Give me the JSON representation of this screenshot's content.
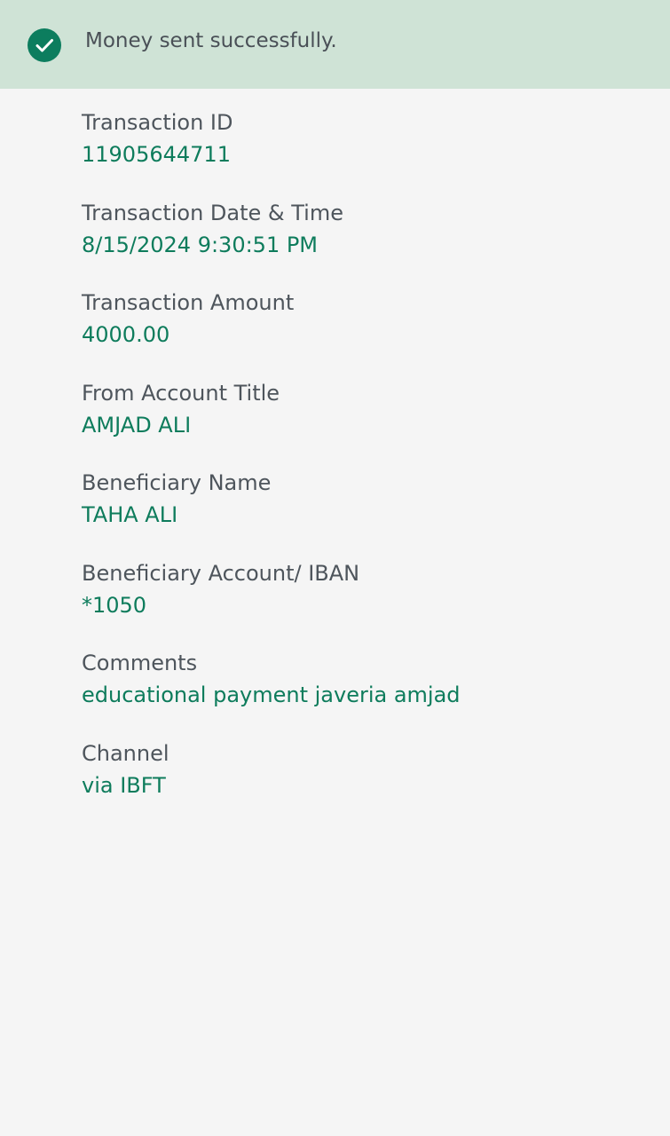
{
  "banner": {
    "message": "Money sent successfully.",
    "icon": "check-circle-icon",
    "background_color": "#cfe3d6",
    "icon_color": "#0c7d5e"
  },
  "details": [
    {
      "label": "Transaction ID",
      "value": "11905644711"
    },
    {
      "label": "Transaction Date & Time",
      "value": "8/15/2024 9:30:51 PM"
    },
    {
      "label": "Transaction Amount",
      "value": "4000.00"
    },
    {
      "label": "From Account Title",
      "value": "AMJAD ALI"
    },
    {
      "label": "Beneficiary Name",
      "value": "TAHA ALI"
    },
    {
      "label": "Beneficiary Account/ IBAN",
      "value": "*1050"
    },
    {
      "label": "Comments",
      "value": "educational payment javeria amjad"
    },
    {
      "label": "Channel",
      "value": "via IBFT"
    }
  ],
  "colors": {
    "label": "#4e555c",
    "value": "#0e7c5c",
    "page_background": "#f5f5f5"
  }
}
